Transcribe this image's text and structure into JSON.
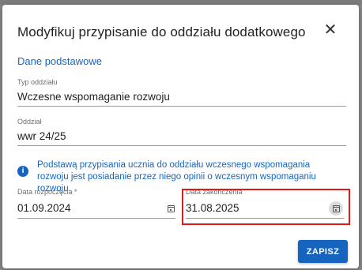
{
  "dialog": {
    "title": "Modyfikuj przypisanie do oddziału dodatkowego",
    "close_symbol": "✕",
    "section_title": "Dane podstawowe"
  },
  "fields": {
    "typ_oddzialu": {
      "label": "Typ oddziału",
      "value": "Wczesne wspomaganie rozwoju"
    },
    "oddzial": {
      "label": "Oddział",
      "value": "wwr 24/25"
    }
  },
  "info": {
    "icon": "info-icon",
    "symbol": "i",
    "text": "Podstawą przypisania ucznia do oddziału wczesnego wspomagania rozwoju jest posiadanie przez niego opinii o wczesnym wspomaganiu rozwoju."
  },
  "dates": {
    "start": {
      "label": "Data rozpoczęcia *",
      "value": "01.09.2024",
      "icon": "calendar-icon"
    },
    "end": {
      "label": "Data zakończenia",
      "value": "31.08.2025",
      "icon": "calendar-icon"
    }
  },
  "actions": {
    "save_label": "ZAPISZ"
  },
  "colors": {
    "accent": "#1565c0",
    "highlight": "#e01919"
  }
}
